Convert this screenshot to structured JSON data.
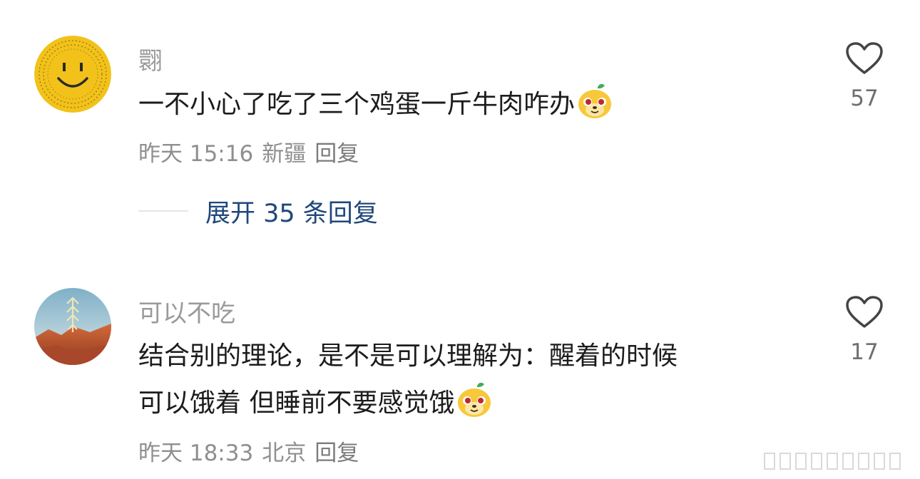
{
  "comments": [
    {
      "username": "翾",
      "text": "一不小心了吃了三个鸡蛋一斤牛肉咋办",
      "time": "昨天 15:16",
      "location": "新疆",
      "reply_label": "回复",
      "like_count": "57",
      "avatar_icon": "smiley-face-avatar",
      "sticker_icon": "cute-dog-emoji"
    },
    {
      "username": "可以不吃",
      "text_line1": "结合别的理论，是不是可以理解为：醒着的时候",
      "text_line2": "可以饿着 但睡前不要感觉饿",
      "time": "昨天 18:33",
      "location": "北京",
      "reply_label": "回复",
      "like_count": "17",
      "avatar_icon": "desert-landscape-avatar",
      "sticker_icon": "cute-dog-emoji"
    }
  ],
  "expand_replies": "展开 35 条回复",
  "colors": {
    "link_blue": "#20477a",
    "muted_text": "#9a9a9a",
    "avatar_yellow": "#f2c21b"
  }
}
